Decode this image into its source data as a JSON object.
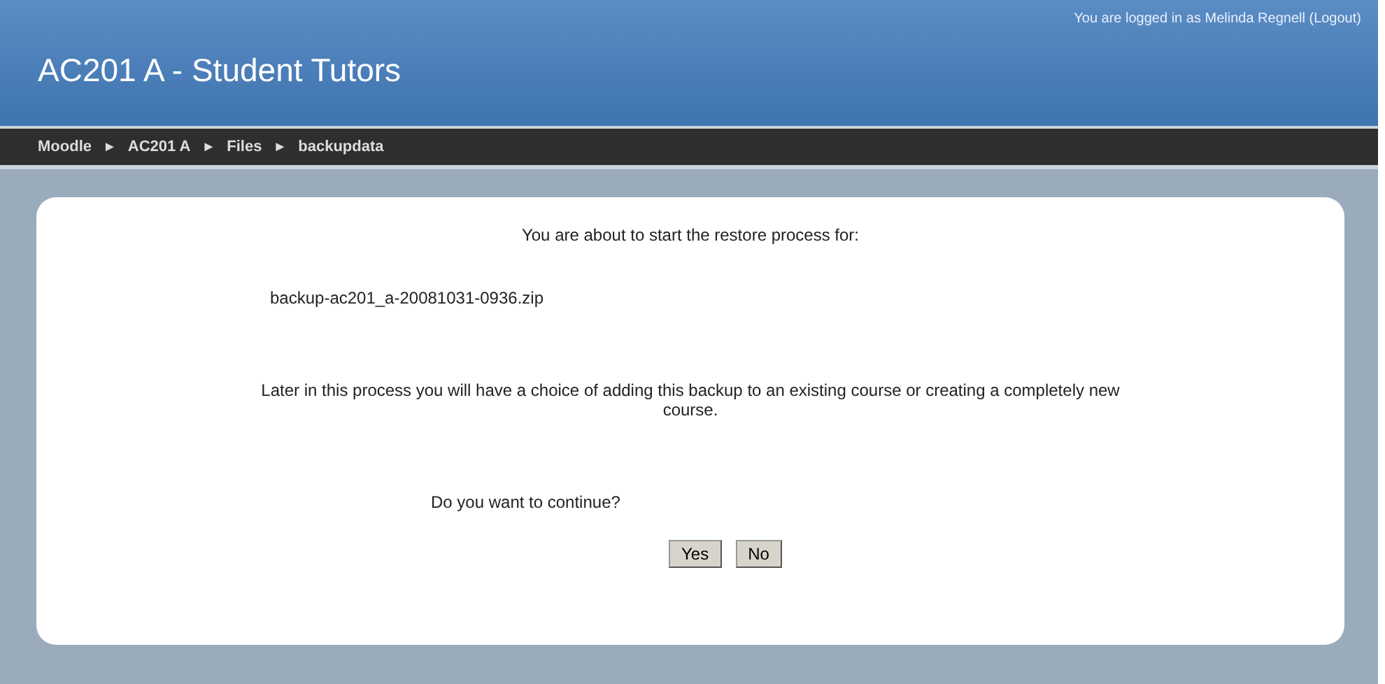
{
  "login": {
    "before": "You are logged in as ",
    "user": "Melinda Regnell",
    "between": " (",
    "logout": "Logout",
    "after": ")"
  },
  "header": {
    "title": "AC201 A - Student Tutors"
  },
  "breadcrumb": {
    "separator": "►",
    "items": [
      "Moodle",
      "AC201 A",
      "Files",
      "backupdata"
    ]
  },
  "content": {
    "intro": "You are about to start the restore process for:",
    "file": "backup-ac201_a-20081031-0936.zip",
    "note": "Later in this process you will have a choice of adding this backup to an existing course or creating a completely new course.",
    "question": "Do you want to continue?",
    "buttons": [
      "Yes",
      "No"
    ]
  }
}
